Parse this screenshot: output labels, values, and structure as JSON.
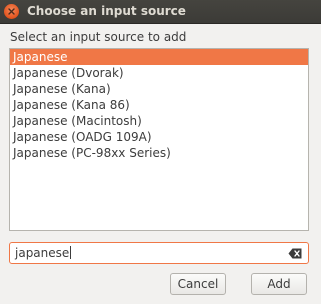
{
  "window": {
    "title": "Choose an input source"
  },
  "dialog": {
    "prompt": "Select an input source to add",
    "sources": [
      "Japanese",
      "Japanese (Dvorak)",
      "Japanese (Kana)",
      "Japanese (Kana 86)",
      "Japanese (Macintosh)",
      "Japanese (OADG 109A)",
      "Japanese (PC-98xx Series)"
    ],
    "selected_index": 0,
    "search_value": "japanese",
    "cancel_label": "Cancel",
    "add_label": "Add"
  },
  "colors": {
    "accent": "#f07746",
    "titlebar": "#3c3b37",
    "close_button": "#e2531d"
  },
  "icons": {
    "close": "close-icon",
    "clear": "clear-text-icon"
  }
}
